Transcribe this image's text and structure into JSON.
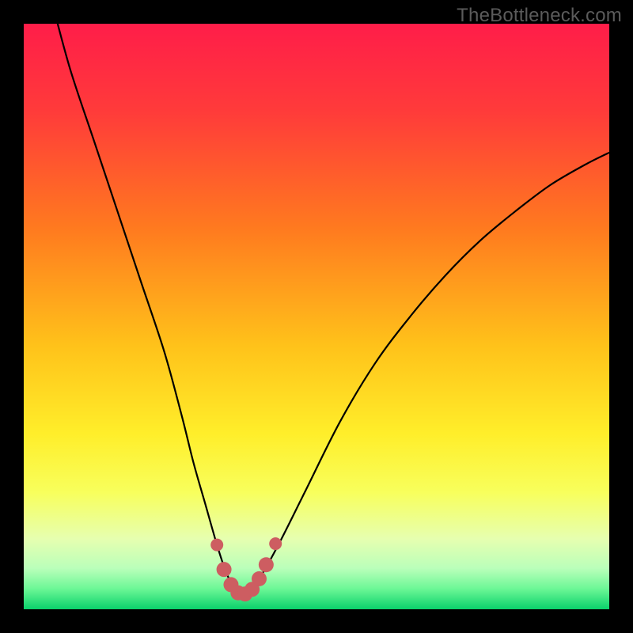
{
  "watermark": "TheBottleneck.com",
  "colors": {
    "frame": "#000000",
    "curve": "#000000",
    "dots": "#cd5d61",
    "gradient_stops": [
      {
        "offset": 0.0,
        "color": "#ff1d49"
      },
      {
        "offset": 0.15,
        "color": "#ff3b3a"
      },
      {
        "offset": 0.35,
        "color": "#ff7a1f"
      },
      {
        "offset": 0.55,
        "color": "#ffc21a"
      },
      {
        "offset": 0.7,
        "color": "#ffee2a"
      },
      {
        "offset": 0.8,
        "color": "#f8ff5c"
      },
      {
        "offset": 0.88,
        "color": "#e6ffb0"
      },
      {
        "offset": 0.93,
        "color": "#baffba"
      },
      {
        "offset": 0.965,
        "color": "#6cf796"
      },
      {
        "offset": 1.0,
        "color": "#0ad16b"
      }
    ]
  },
  "chart_data": {
    "type": "line",
    "title": "",
    "xlabel": "",
    "ylabel": "",
    "xlim": [
      0,
      100
    ],
    "ylim": [
      0,
      100
    ],
    "grid": false,
    "series": [
      {
        "name": "bottleneck-curve",
        "x": [
          5,
          8,
          12,
          16,
          20,
          24,
          27,
          29,
          31,
          33,
          34.5,
          36,
          37.5,
          39,
          41,
          44,
          48,
          54,
          60,
          66,
          72,
          78,
          84,
          90,
          96,
          100
        ],
        "y": [
          103,
          92,
          80,
          68,
          56,
          44,
          33,
          25,
          18,
          11,
          6.5,
          3.5,
          2.5,
          3.5,
          6.5,
          12,
          20,
          32,
          42,
          50,
          57,
          63,
          68,
          72.5,
          76,
          78
        ]
      }
    ],
    "highlight_dots": {
      "name": "optimal-range",
      "x": [
        33.0,
        34.2,
        35.4,
        36.6,
        37.8,
        39.0,
        40.2,
        41.4,
        43.0
      ],
      "y": [
        11.0,
        6.8,
        4.2,
        2.8,
        2.6,
        3.4,
        5.2,
        7.6,
        11.2
      ]
    }
  }
}
